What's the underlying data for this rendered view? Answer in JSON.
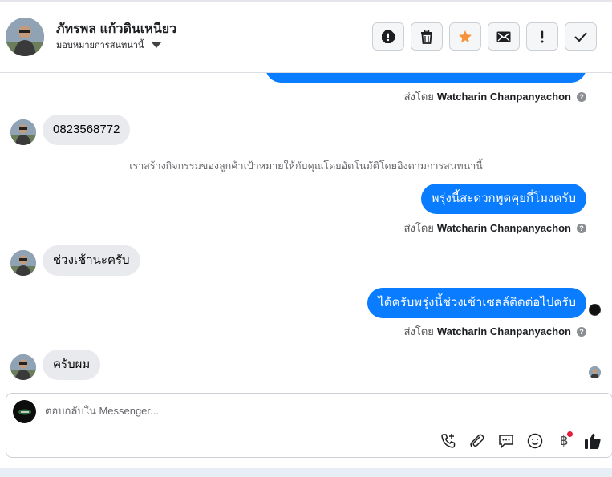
{
  "header": {
    "contact_name": "ภัทรพล แก้วดินเหนียว",
    "assign_label": "มอบหมายการสนทนานี้",
    "toolbar": [
      {
        "name": "spam-icon"
      },
      {
        "name": "trash-icon"
      },
      {
        "name": "star-icon",
        "color": "#f7923b"
      },
      {
        "name": "envelope-icon"
      },
      {
        "name": "exclamation-icon"
      },
      {
        "name": "check-icon"
      }
    ]
  },
  "thread": {
    "sent_prefix": "ส่งโดย",
    "sender": "Watcharin Chanpanyachon",
    "messages": [
      {
        "from": "customer",
        "text": "0823568772"
      },
      {
        "type": "system",
        "text": "เราสร้างกิจกรรมของลูกค้าเป้าหมายให้กับคุณโดยอัตโนมัติโดยอิงตามการสนทนานี้"
      },
      {
        "from": "page",
        "text": "พรุ่งนี้สะดวกพูดคุยกี่โมงครับ"
      },
      {
        "from": "customer",
        "text": "ช่วงเช้านะครับ"
      },
      {
        "from": "page",
        "text": "ได้ครับพรุ่งนี้ช่วงเช้าเซลล์ติดต่อไปครับ"
      },
      {
        "from": "customer",
        "text": "ครับผม"
      }
    ]
  },
  "composer": {
    "placeholder": "ตอบกลับใน Messenger...",
    "tools": [
      "phone-add-icon",
      "paperclip-icon",
      "saved-reply-icon",
      "emoji-icon",
      "baht-icon",
      "thumbs-up-icon"
    ],
    "baht_symbol": "฿"
  },
  "colors": {
    "outgoing_bubble": "#0a7cff",
    "incoming_bubble": "#e9eaed",
    "notification_dot": "#e41e3f"
  }
}
